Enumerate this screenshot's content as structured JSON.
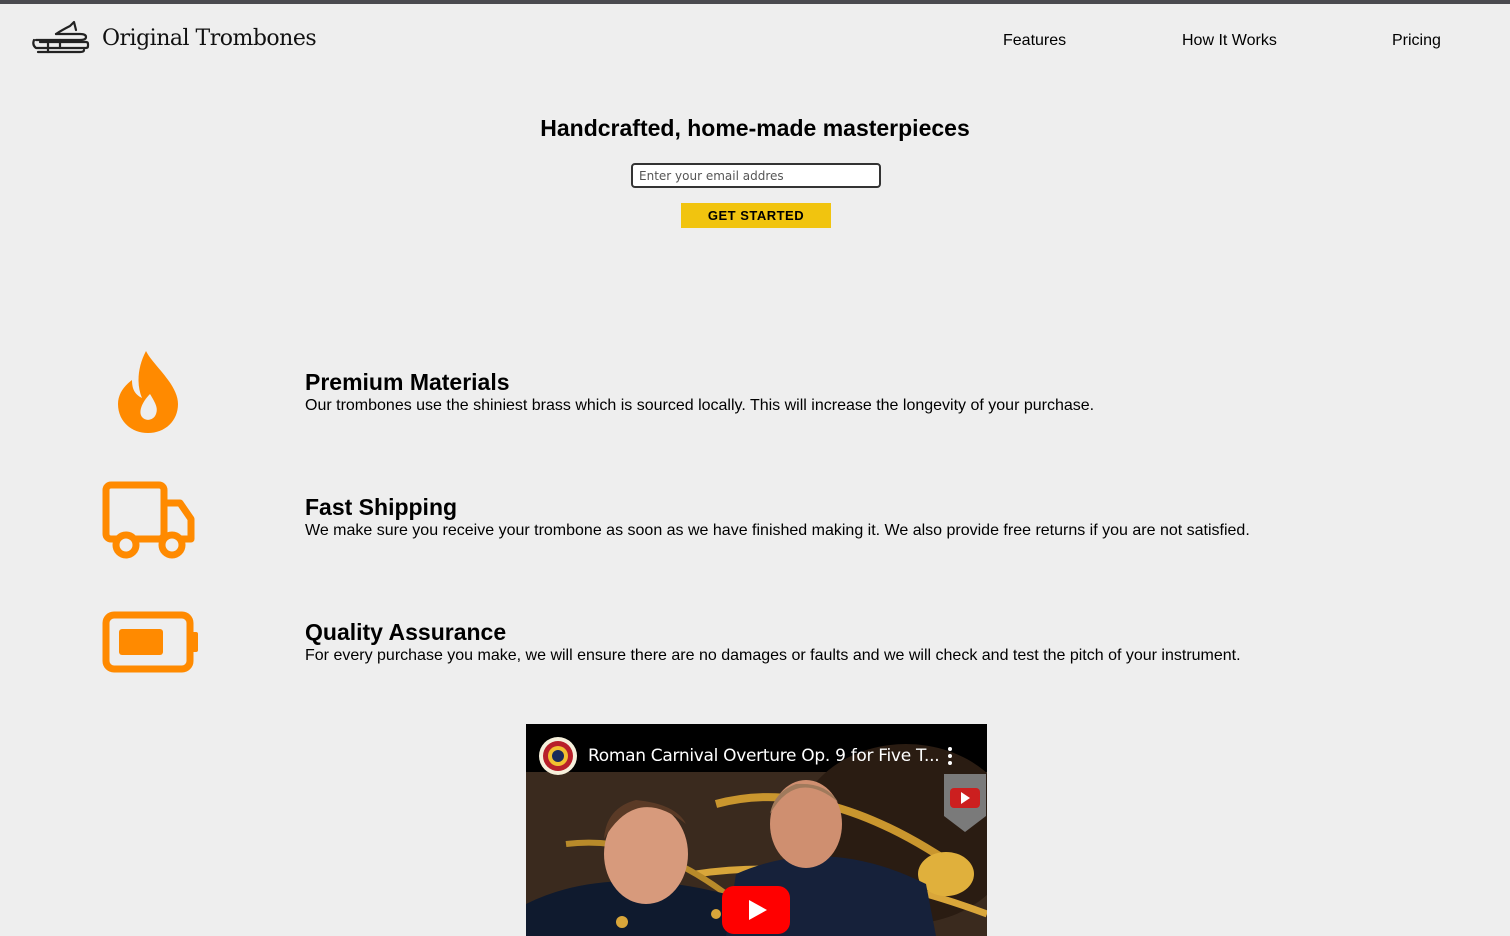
{
  "header": {
    "logo_text": "Original Trombones",
    "logo_icon": "trombone-icon",
    "nav": [
      {
        "label": "Features"
      },
      {
        "label": "How It Works"
      },
      {
        "label": "Pricing"
      }
    ]
  },
  "hero": {
    "title": "Handcrafted, home-made masterpieces",
    "email_placeholder": "Enter your email addres",
    "cta_label": "GET STARTED"
  },
  "features": [
    {
      "icon": "flame-icon",
      "title": "Premium Materials",
      "description": "Our trombones use the shiniest brass which is sourced locally. This will increase the longevity of your purchase."
    },
    {
      "icon": "truck-icon",
      "title": "Fast Shipping",
      "description": "We make sure you receive your trombone as soon as we have finished making it. We also provide free returns if you are not satisfied."
    },
    {
      "icon": "battery-icon",
      "title": "Quality Assurance",
      "description": "For every purchase you make, we will ensure there are no damages or faults and we will check and test the pitch of your instrument."
    }
  ],
  "video": {
    "title": "Roman Carnival Overture Op. 9 for Five T..."
  },
  "colors": {
    "accent": "#f1c40f",
    "icon_orange": "#ff8a00",
    "youtube_red": "#ff0000",
    "topbar": "#4a4a4f",
    "background": "#eeeeee"
  }
}
